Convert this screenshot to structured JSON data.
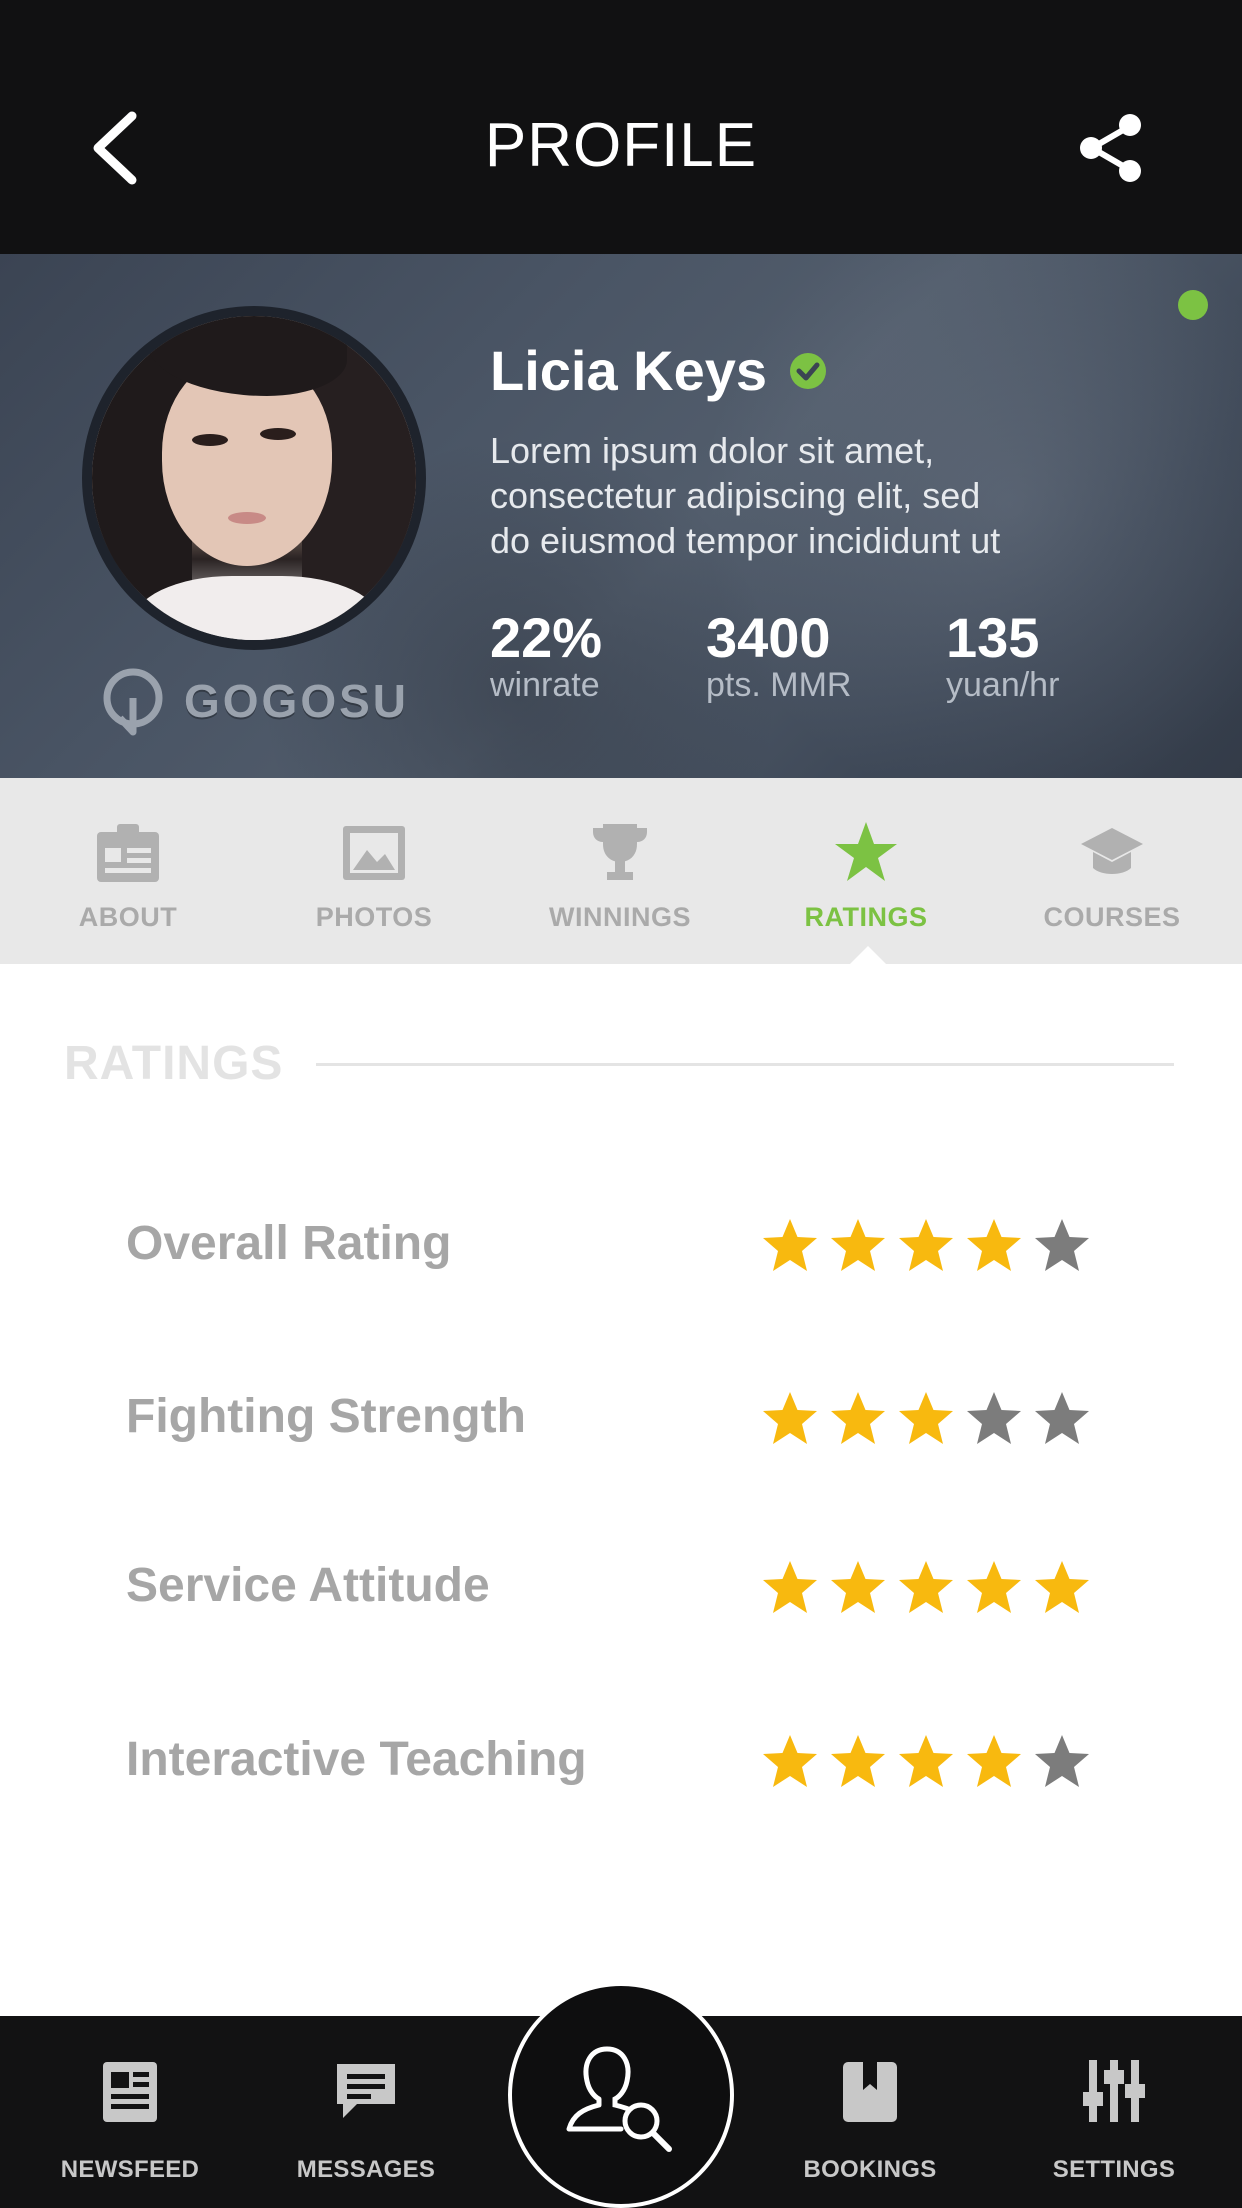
{
  "header": {
    "title": "PROFILE",
    "back_icon": "chevron-left-icon",
    "share_icon": "share-icon"
  },
  "profile": {
    "name": "Licia Keys",
    "verified_icon": "verified-check-icon",
    "online_status_color": "#7cc243",
    "bio_lines": [
      "Lorem ipsum dolor sit amet,",
      "consectetur adipiscing elit, sed",
      "do eiusmod tempor incididunt ut"
    ],
    "brand": "GOGOSU",
    "stats": [
      {
        "value": "22%",
        "label": "winrate"
      },
      {
        "value": "3400",
        "label": "pts. MMR"
      },
      {
        "value": "135",
        "label": "yuan/hr"
      }
    ]
  },
  "tabs": [
    {
      "label": "ABOUT",
      "icon": "clipboard-icon",
      "active": false
    },
    {
      "label": "PHOTOS",
      "icon": "image-icon",
      "active": false
    },
    {
      "label": "WINNINGS",
      "icon": "trophy-icon",
      "active": false
    },
    {
      "label": "RATINGS",
      "icon": "star-icon",
      "active": true
    },
    {
      "label": "COURSES",
      "icon": "graduation-cap-icon",
      "active": false
    }
  ],
  "ratings": {
    "section_title": "RATINGS",
    "max_stars": 5,
    "items": [
      {
        "label": "Overall Rating",
        "stars": 4
      },
      {
        "label": "Fighting Strength",
        "stars": 3
      },
      {
        "label": "Service Attitude",
        "stars": 5
      },
      {
        "label": "Interactive Teaching",
        "stars": 4
      }
    ]
  },
  "colors": {
    "accent_green": "#7cc243",
    "star_filled": "#f8b90f",
    "star_empty": "#7c7c7c",
    "header_bg": "#111112"
  },
  "bottom_nav": {
    "items": [
      {
        "label": "NEWSFEED",
        "icon": "newspaper-icon"
      },
      {
        "label": "MESSAGES",
        "icon": "chat-bubble-icon"
      },
      {
        "label": "BOOKINGS",
        "icon": "bookmark-icon"
      },
      {
        "label": "SETTINGS",
        "icon": "sliders-icon"
      }
    ],
    "center_icon": "user-search-icon"
  }
}
